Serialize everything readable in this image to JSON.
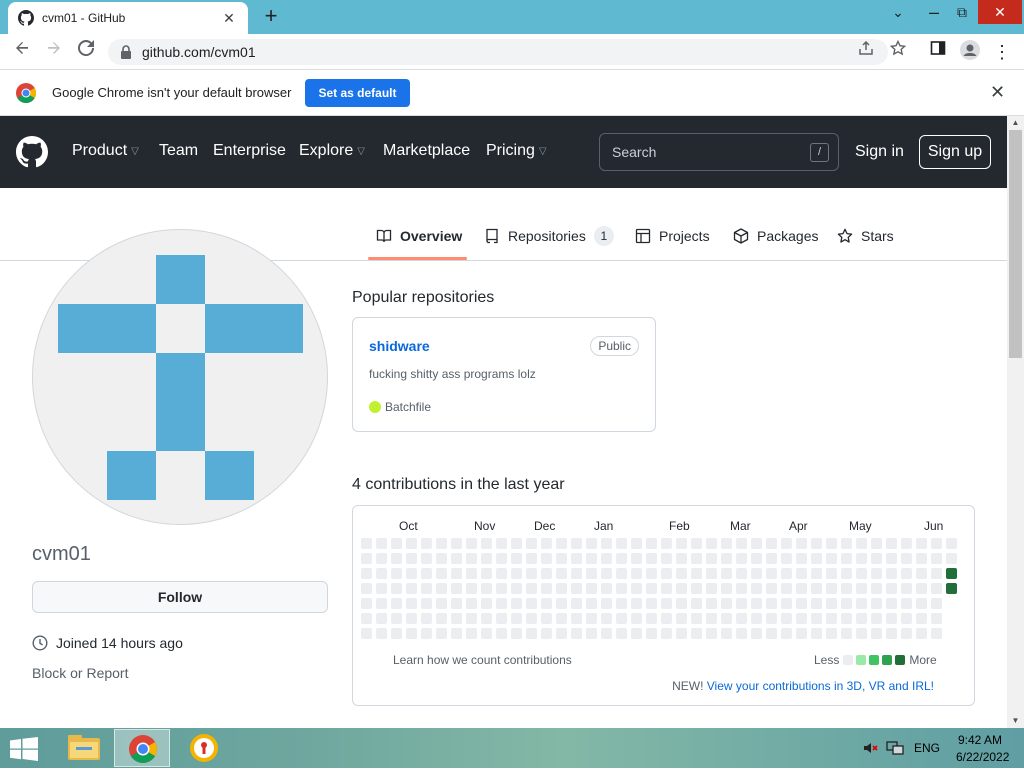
{
  "browser": {
    "tab_title": "cvm01 - GitHub",
    "tab_close": "✕",
    "new_tab": "+",
    "url": "github.com/cvm01",
    "window": {
      "minimize": "⌄",
      "maximize": "⧉",
      "close": "✕"
    },
    "infobar": {
      "message": "Google Chrome isn't your default browser",
      "button": "Set as default",
      "close": "✕"
    }
  },
  "header": {
    "nav": [
      {
        "label": "Product",
        "dropdown": true
      },
      {
        "label": "Team",
        "dropdown": false
      },
      {
        "label": "Enterprise",
        "dropdown": false
      },
      {
        "label": "Explore",
        "dropdown": true
      },
      {
        "label": "Marketplace",
        "dropdown": false
      },
      {
        "label": "Pricing",
        "dropdown": true
      }
    ],
    "search_placeholder": "Search",
    "search_shortcut": "/",
    "sign_in": "Sign in",
    "sign_up": "Sign up"
  },
  "profile_tabs": [
    {
      "label": "Overview",
      "icon": "book-icon",
      "active": true
    },
    {
      "label": "Repositories",
      "icon": "repo-icon",
      "count": "1"
    },
    {
      "label": "Projects",
      "icon": "table-icon"
    },
    {
      "label": "Packages",
      "icon": "package-icon"
    },
    {
      "label": "Stars",
      "icon": "star-icon"
    }
  ],
  "profile": {
    "username": "cvm01",
    "follow": "Follow",
    "joined": "Joined 14 hours ago",
    "block_report": "Block or Report"
  },
  "popular": {
    "heading": "Popular repositories",
    "repo": {
      "name": "shidware",
      "visibility": "Public",
      "description": "fucking shitty ass programs lolz",
      "language": "Batchfile",
      "language_color": "#c1f12e"
    }
  },
  "contributions": {
    "heading": "4 contributions in the last year",
    "months": [
      "Oct",
      "Nov",
      "Dec",
      "Jan",
      "Feb",
      "Mar",
      "Apr",
      "May",
      "Jun"
    ],
    "learn": "Learn how we count contributions",
    "less": "Less",
    "more": "More",
    "new_label": "NEW!",
    "new_link": "View your contributions in 3D, VR and IRL!",
    "colors": [
      "#ebedf0",
      "#9be9a8",
      "#40c463",
      "#30a14e",
      "#216e39"
    ]
  },
  "taskbar": {
    "lang": "ENG",
    "time": "9:42 AM",
    "date": "6/22/2022"
  }
}
